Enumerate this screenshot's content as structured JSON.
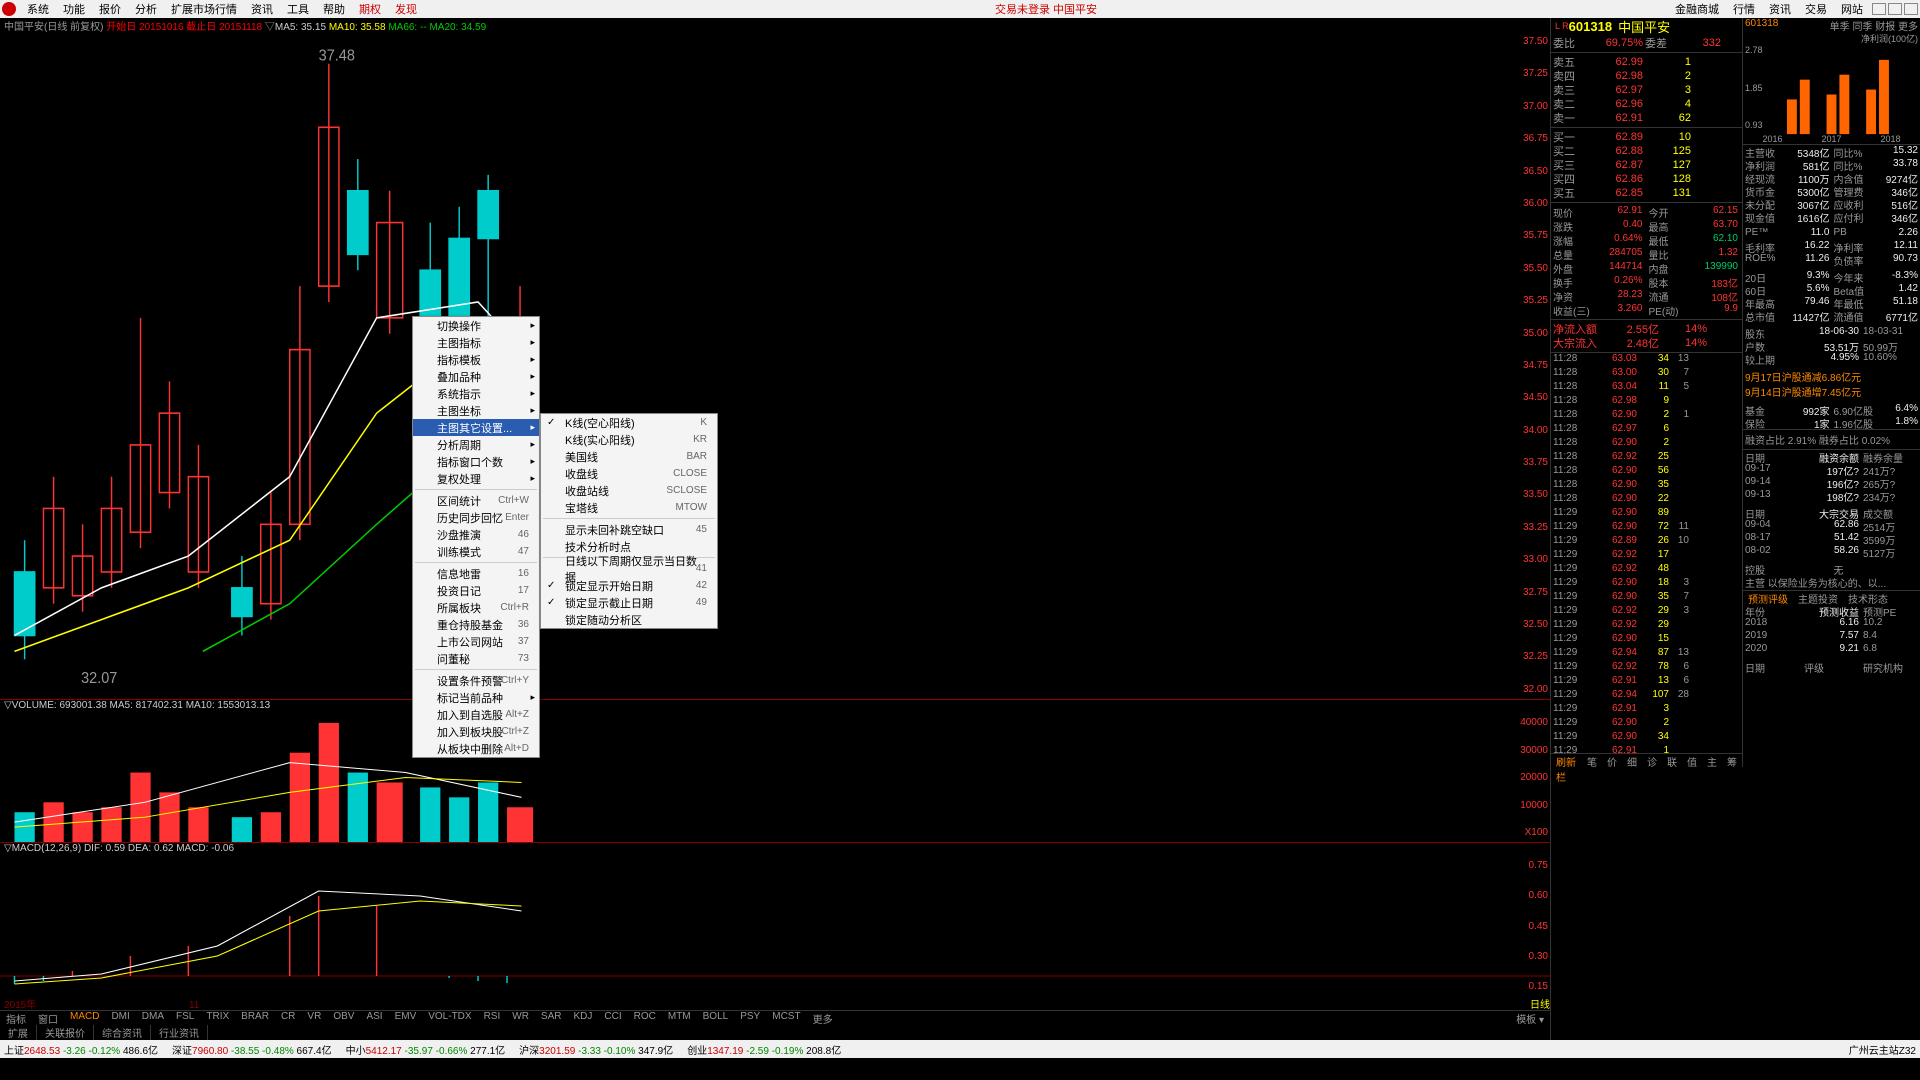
{
  "menubar": {
    "items": [
      "系统",
      "功能",
      "报价",
      "分析",
      "扩展市场行情",
      "资讯",
      "工具",
      "帮助"
    ],
    "red_items": [
      "期权",
      "发现"
    ],
    "center": "交易未登录 中国平安",
    "right": [
      "金融商城",
      "行情",
      "资讯",
      "交易",
      "网站"
    ]
  },
  "chart_header": {
    "title": "中国平安(日线 前复权)",
    "start_lbl": "开始日",
    "start": "20151016",
    "end_lbl": "截止日",
    "end": "20151118",
    "ma5": "MA5: 35.15",
    "ma10": "MA10: 35.58",
    "ma66": "MA66: --",
    "ma20": "MA20: 34.59"
  },
  "price_hi": "37.48",
  "price_lo": "32.07",
  "yaxis": [
    "37.50",
    "37.25",
    "37.00",
    "36.75",
    "36.50",
    "36.00",
    "35.75",
    "35.50",
    "35.25",
    "35.00",
    "34.75",
    "34.50",
    "34.00",
    "33.75",
    "33.50",
    "33.25",
    "33.00",
    "32.75",
    "32.50",
    "32.25",
    "32.00"
  ],
  "vol_head": "VOLUME: 693001.38  MA5: 817402.31  MA10: 1553013.13",
  "vol_axis": [
    "40000",
    "30000",
    "20000",
    "10000",
    "X100"
  ],
  "macd_head": "MACD(12,26,9) DIF: 0.59 DEA: 0.62 MACD: -0.06",
  "macd_axis": [
    "0.75",
    "0.60",
    "0.45",
    "0.30",
    "0.15"
  ],
  "time_axis": {
    "year": "2015年",
    "month": "11",
    "right": "日线"
  },
  "ind_tabs": {
    "left": [
      "指标",
      "窗口"
    ],
    "items": [
      "MACD",
      "DMI",
      "DMA",
      "FSL",
      "TRIX",
      "BRAR",
      "CR",
      "VR",
      "OBV",
      "ASI",
      "EMV",
      "VOL-TDX",
      "RSI",
      "WR",
      "SAR",
      "KDJ",
      "CCI",
      "ROC",
      "MTM",
      "BOLL",
      "PSY",
      "MCST",
      "更多"
    ],
    "sel": "MACD",
    "right": "模板"
  },
  "bottom_tabs": [
    "扩展",
    "关联报价",
    "综合资讯",
    "行业资讯"
  ],
  "ctx1": [
    {
      "t": "切换操作",
      "a": true
    },
    {
      "t": "主图指标",
      "a": true
    },
    {
      "t": "指标模板",
      "a": true
    },
    {
      "t": "叠加品种",
      "a": true
    },
    {
      "t": "系统指示",
      "a": true
    },
    {
      "t": "主图坐标",
      "a": true
    },
    {
      "t": "主图其它设置...",
      "a": true,
      "hl": true
    },
    {
      "t": "分析周期",
      "a": true
    },
    {
      "t": "指标窗口个数",
      "a": true
    },
    {
      "t": "复权处理",
      "a": true
    },
    {
      "sep": true
    },
    {
      "t": "区间统计",
      "sc": "Ctrl+W"
    },
    {
      "t": "历史同步回忆",
      "sc": "Enter"
    },
    {
      "t": "沙盘推演",
      "sc": "46"
    },
    {
      "t": "训练模式",
      "sc": "47"
    },
    {
      "sep": true
    },
    {
      "t": "信息地雷",
      "sc": "16"
    },
    {
      "t": "投资日记",
      "sc": "17"
    },
    {
      "t": "所属板块",
      "sc": "Ctrl+R"
    },
    {
      "t": "重仓持股基金",
      "sc": "36"
    },
    {
      "t": "上市公司网站",
      "sc": "37"
    },
    {
      "t": "问董秘",
      "sc": "73"
    },
    {
      "sep": true
    },
    {
      "t": "设置条件预警",
      "sc": "Ctrl+Y"
    },
    {
      "t": "标记当前品种",
      "a": true
    },
    {
      "t": "加入到自选股",
      "sc": "Alt+Z"
    },
    {
      "t": "加入到板块股",
      "sc": "Ctrl+Z"
    },
    {
      "t": "从板块中删除",
      "sc": "Alt+D"
    }
  ],
  "ctx2": [
    {
      "t": "K线(空心阳线)",
      "sc": "K",
      "chk": true
    },
    {
      "t": "K线(实心阳线)",
      "sc": "KR"
    },
    {
      "t": "美国线",
      "sc": "BAR"
    },
    {
      "t": "收盘线",
      "sc": "CLOSE"
    },
    {
      "t": "收盘站线",
      "sc": "SCLOSE"
    },
    {
      "t": "宝塔线",
      "sc": "MTOW"
    },
    {
      "sep": true
    },
    {
      "t": "显示未回补跳空缺口",
      "sc": "45"
    },
    {
      "t": "技术分析时点"
    },
    {
      "sep": true
    },
    {
      "t": "日线以下周期仅显示当日数据",
      "sc": "41"
    },
    {
      "t": "锁定显示开始日期",
      "sc": "42",
      "chk": true
    },
    {
      "t": "锁定显示截止日期",
      "sc": "49",
      "chk": true
    },
    {
      "t": "锁定随动分析区"
    }
  ],
  "stock": {
    "code": "601318",
    "name": "中国平安",
    "head_tabs": [
      "单季",
      "同季",
      "财报",
      "更多"
    ]
  },
  "weibi": {
    "lbl": "委比",
    "v": "69.75%",
    "diff_lbl": "委差",
    "diff": "332"
  },
  "asks": [
    [
      "卖五",
      "62.99",
      "1"
    ],
    [
      "卖四",
      "62.98",
      "2"
    ],
    [
      "卖三",
      "62.97",
      "3"
    ],
    [
      "卖二",
      "62.96",
      "4"
    ],
    [
      "卖一",
      "62.91",
      "62"
    ]
  ],
  "bids": [
    [
      "买一",
      "62.89",
      "10"
    ],
    [
      "买二",
      "62.88",
      "125"
    ],
    [
      "买三",
      "62.87",
      "127"
    ],
    [
      "买四",
      "62.86",
      "128"
    ],
    [
      "买五",
      "62.85",
      "131"
    ]
  ],
  "quote": [
    [
      "现价",
      "62.91",
      "今开",
      "62.15"
    ],
    [
      "涨跌",
      "0.40",
      "最高",
      "63.70"
    ],
    [
      "涨幅",
      "0.64%",
      "最低",
      "62.10"
    ],
    [
      "总量",
      "284705",
      "量比",
      "1.32"
    ],
    [
      "外盘",
      "144714",
      "内盘",
      "139990"
    ],
    [
      "换手",
      "0.26%",
      "股本",
      "183亿"
    ],
    [
      "净资",
      "28.23",
      "流通",
      "108亿"
    ],
    [
      "收益(三)",
      "3.260",
      "PE(动)",
      "9.9"
    ]
  ],
  "flows": [
    [
      "净流入额",
      "2.55亿",
      "14%"
    ],
    [
      "大宗流入",
      "2.48亿",
      "14%"
    ]
  ],
  "ticks": [
    [
      "11:28",
      "63.03",
      "34",
      "13"
    ],
    [
      "11:28",
      "63.00",
      "30",
      "7"
    ],
    [
      "11:28",
      "63.04",
      "11",
      "5"
    ],
    [
      "11:28",
      "62.98",
      "9",
      ""
    ],
    [
      "11:28",
      "62.90",
      "2",
      "1"
    ],
    [
      "11:28",
      "62.97",
      "6",
      ""
    ],
    [
      "11:28",
      "62.90",
      "2",
      ""
    ],
    [
      "11:28",
      "62.92",
      "25",
      ""
    ],
    [
      "11:28",
      "62.90",
      "56",
      ""
    ],
    [
      "11:28",
      "62.90",
      "35",
      ""
    ],
    [
      "11:28",
      "62.90",
      "22",
      ""
    ],
    [
      "11:29",
      "62.90",
      "89",
      ""
    ],
    [
      "11:29",
      "62.90",
      "72",
      "11"
    ],
    [
      "11:29",
      "62.89",
      "26",
      "10"
    ],
    [
      "11:29",
      "62.92",
      "17",
      ""
    ],
    [
      "11:29",
      "62.92",
      "48",
      ""
    ],
    [
      "11:29",
      "62.90",
      "18",
      "3"
    ],
    [
      "11:29",
      "62.90",
      "35",
      "7"
    ],
    [
      "11:29",
      "62.92",
      "29",
      "3"
    ],
    [
      "11:29",
      "62.92",
      "29",
      ""
    ],
    [
      "11:29",
      "62.90",
      "15",
      ""
    ],
    [
      "11:29",
      "62.94",
      "87",
      "13"
    ],
    [
      "11:29",
      "62.92",
      "78",
      "6"
    ],
    [
      "11:29",
      "62.91",
      "13",
      "6"
    ],
    [
      "11:29",
      "62.94",
      "107",
      "28"
    ],
    [
      "11:29",
      "62.91",
      "3",
      ""
    ],
    [
      "11:29",
      "62.90",
      "2",
      ""
    ],
    [
      "11:29",
      "62.90",
      "34",
      ""
    ],
    [
      "11:29",
      "62.91",
      "1",
      ""
    ]
  ],
  "mini_axis": [
    "2.78",
    "1.85",
    "0.93"
  ],
  "mini_years": [
    "2016",
    "2017",
    "2018"
  ],
  "mini_right": "净利润(100亿)",
  "fin1": [
    [
      "主营收",
      "5348亿",
      "同比%",
      "15.32"
    ],
    [
      "净利润",
      "581亿",
      "同比%",
      "33.78"
    ],
    [
      "经现流",
      "1100万",
      "内含值",
      "9274亿"
    ],
    [
      "货币金",
      "5300亿",
      "管理费",
      "346亿"
    ],
    [
      "未分配",
      "3067亿",
      "应收利",
      "516亿"
    ],
    [
      "现金值",
      "1616亿",
      "应付利",
      "346亿"
    ]
  ],
  "fin2": [
    [
      "PE™",
      "11.0",
      "PB",
      "2.26"
    ],
    [
      "毛利率",
      "16.22",
      "净利率",
      "12.11"
    ],
    [
      "ROE%",
      "11.26",
      "负债率",
      "90.73"
    ]
  ],
  "fin3": [
    [
      "20日",
      "9.3%",
      "今年来",
      "-8.3%"
    ],
    [
      "60日",
      "5.6%",
      "Beta值",
      "1.42"
    ],
    [
      "年最高",
      "79.46",
      "年最低",
      "51.18"
    ],
    [
      "总市值",
      "11427亿",
      "流通值",
      "6771亿"
    ]
  ],
  "fin4": [
    [
      "股东",
      "18-06-30",
      "18-03-31"
    ],
    [
      "户数",
      "53.51万",
      "50.99万"
    ],
    [
      "较上期",
      "4.95%",
      "10.60%"
    ]
  ],
  "news": [
    "9月17日沪股通减6.86亿元",
    "9月14日沪股通增7.45亿元"
  ],
  "fund": [
    [
      "基金",
      "992家",
      "6.90亿股",
      "6.4%"
    ],
    [
      "保险",
      "1家",
      "1.96亿股",
      "1.8%"
    ]
  ],
  "margin_lbl": "融资占比 2.91% 融券占比 0.02%",
  "margin": [
    [
      "日期",
      "融资余额",
      "融券余量"
    ],
    [
      "09-17",
      "197亿?",
      "241万?"
    ],
    [
      "09-14",
      "196亿?",
      "265万?"
    ],
    [
      "09-13",
      "198亿?",
      "234万?"
    ]
  ],
  "block": [
    [
      "日期",
      "大宗交易",
      "成交额"
    ],
    [
      "09-04",
      "62.86",
      "2514万"
    ],
    [
      "08-17",
      "51.42",
      "3599万"
    ],
    [
      "08-02",
      "58.26",
      "5127万"
    ]
  ],
  "ctrl": {
    "lbl": "控股",
    "v": "无",
    "main": "主营 以保险业务为核心的、以..."
  },
  "pred_tabs": [
    "预测评级",
    "主题投资",
    "技术形态"
  ],
  "pred": [
    [
      "年份",
      "预测收益",
      "预测PE"
    ],
    [
      "2018",
      "6.16",
      "10.2"
    ],
    [
      "2019",
      "7.57",
      "8.4"
    ],
    [
      "2020",
      "9.21",
      "6.8"
    ]
  ],
  "pred2": [
    "日期",
    "评级",
    "研究机构"
  ],
  "status": {
    "idx": [
      [
        "上证",
        "2648.53",
        "-3.26",
        "-0.12%",
        "486.6亿"
      ],
      [
        "深证",
        "7960.80",
        "-38.55",
        "-0.48%",
        "667.4亿"
      ],
      [
        "中小",
        "5412.17",
        "-35.97",
        "-0.66%",
        "277.1亿"
      ],
      [
        "沪深",
        "3201.59",
        "-3.33",
        "-0.10%",
        "347.9亿"
      ],
      [
        "创业",
        "1347.19",
        "-2.59",
        "-0.19%",
        "208.8亿"
      ]
    ],
    "right": "广州云主站Z32"
  },
  "side_bottom": [
    "刷新栏",
    "笔",
    "价",
    "细",
    "诊",
    "联",
    "值",
    "主",
    "筹"
  ],
  "chart_data": {
    "type": "candlestick",
    "title": "中国平安 日线 前复权",
    "date_range": [
      "20151016",
      "20151118"
    ],
    "ohlc_sample": {
      "high": 37.48,
      "low": 32.07
    },
    "ma": {
      "MA5": 35.15,
      "MA10": 35.58,
      "MA20": 34.59
    },
    "volume": {
      "latest": 693001.38,
      "ma5": 817402.31,
      "ma10": 1553013.13,
      "unit": "x100"
    },
    "macd": {
      "params": [
        12,
        26,
        9
      ],
      "dif": 0.59,
      "dea": 0.62,
      "macd": -0.06
    }
  }
}
